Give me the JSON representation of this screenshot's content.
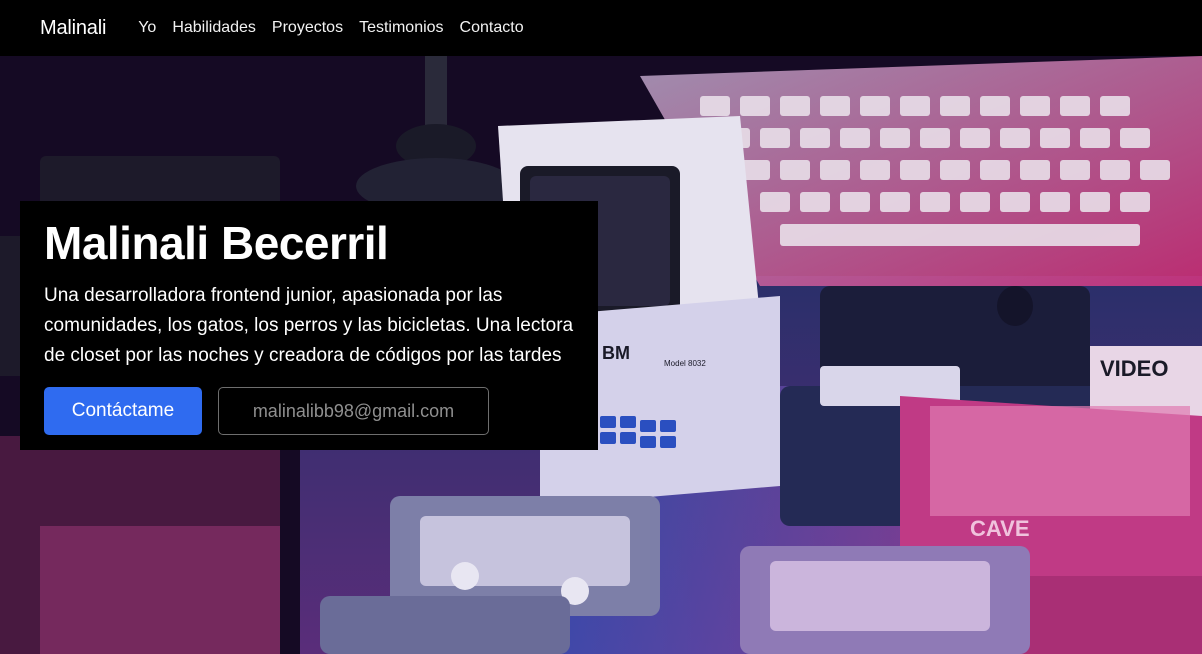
{
  "navbar": {
    "brand": "Malinali",
    "links": [
      "Yo",
      "Habilidades",
      "Proyectos",
      "Testimonios",
      "Contacto"
    ]
  },
  "hero": {
    "title": "Malinali Becerril",
    "description": "Una desarrolladora frontend junior, apasionada por las comunidades, los gatos, los perros y las bicicletas. Una lectora de closet por las noches y creadora de códigos por las tardes",
    "primary_button": "Contáctame",
    "email_button": "malinalibb98@gmail.com",
    "background_image_text": {
      "monitor_brand": "BM",
      "monitor_model": "Model 8032",
      "box_label_1": "VIDEO",
      "box_label_2": "CAVE"
    }
  },
  "colors": {
    "navbar_bg": "#000000",
    "primary_button": "#2f6bf0",
    "hero_tint_pink": "#d8337f",
    "hero_tint_blue": "#3a6fd8"
  }
}
